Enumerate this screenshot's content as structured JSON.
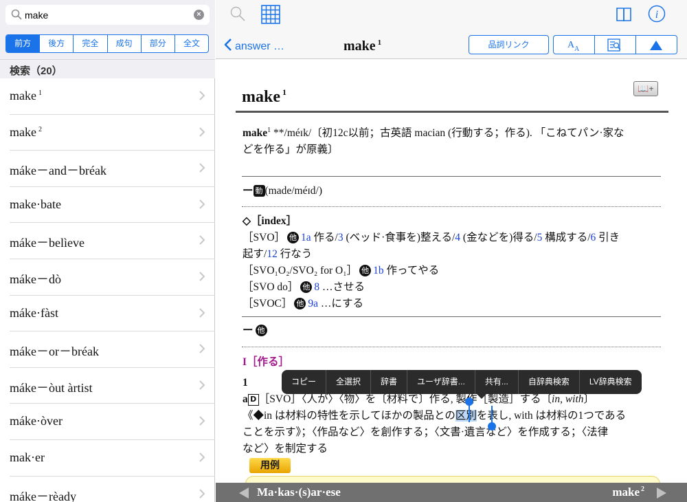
{
  "search": {
    "value": "make"
  },
  "modes": [
    {
      "label": "前方",
      "active": true
    },
    {
      "label": "後方",
      "active": false
    },
    {
      "label": "完全",
      "active": false
    },
    {
      "label": "成句",
      "active": false
    },
    {
      "label": "部分",
      "active": false
    },
    {
      "label": "全文",
      "active": false
    }
  ],
  "result_count": "検索（20）",
  "results": [
    {
      "word": "make",
      "sup": "1"
    },
    {
      "word": "make",
      "sup": "2"
    },
    {
      "word": "máke－and－bréak",
      "sup": ""
    },
    {
      "word": "make·bate",
      "sup": ""
    },
    {
      "word": "máke－belìeve",
      "sup": ""
    },
    {
      "word": "máke－dò",
      "sup": ""
    },
    {
      "word": "máke·fàst",
      "sup": ""
    },
    {
      "word": "máke－or－bréak",
      "sup": ""
    },
    {
      "word": "máke－òut àrtist",
      "sup": ""
    },
    {
      "word": "máke·òver",
      "sup": ""
    },
    {
      "word": "mak·er",
      "sup": ""
    },
    {
      "word": "máke－rèady",
      "sup": ""
    }
  ],
  "nav": {
    "back_label": "answer …",
    "title": "make",
    "title_sup": "1",
    "pos_link_label": "品詞リンク"
  },
  "entry": {
    "headword": "make",
    "headword_sup": "1",
    "add_icon_label": "📖+",
    "etym_head": "make",
    "etym_sup": "1",
    "etym_text1": " **/méɪk/〔初12c以前；古英語 macian (行動する；作る). 「こねてパン·家な",
    "etym_text2": "どを作る」が原義〕",
    "verb_dash": "ー",
    "verb_mark": "動",
    "verb_forms": "(made/méɪd/)",
    "index_head": "◇［index］",
    "svo_label": "［SVO］",
    "ta": "他",
    "svo_1a": "1a",
    "svo_1a_text": " 作る/",
    "svo_3": "3",
    "svo_3_text": " (ベッド·食事を)整える/",
    "svo_4": "4",
    "svo_4_text": " (金などを)得る/",
    "svo_5": "5",
    "svo_5_text": " 構成する/",
    "svo_6": "6",
    "svo_6_text": " 引き",
    "svo_line2a": "起す/",
    "svo_12": "12",
    "svo_line2b": " 行なう",
    "svoo_label": "［SVO₁O₂/SVO₂ for O₁］",
    "svoo_1b": "1b",
    "svoo_text": " 作ってやる",
    "svodo_label": "［SVO do］",
    "svodo_8": "8",
    "svodo_text": " …させる",
    "svoc_label": "［SVOC］",
    "svoc_9a": "9a",
    "svoc_text": " …にする",
    "ta_dash": "ー",
    "sense_head": "I［作る］",
    "sense_num": "1",
    "sense_a": "a",
    "sense_d": "D",
    "sense_line1": "［SVO］〈人が〉〈物〉を〔材料で〕作る, 製作［製造］する〔",
    "sense_in_with": "in, with",
    "sense_line1_end": "〕",
    "sense_line2a": "《◆in は材料の特性を示してほかの製品との",
    "sense_selected": "区別",
    "sense_line2b": "を表し, with は材料の1つである",
    "sense_line3": "ことを示す》；〈作品など〉を創作する；〈文書·遺言など〉を作成する；〈法律",
    "sense_line4": "など〉を制定する",
    "yourei": "用例"
  },
  "context_menu": [
    "コピー",
    "全選択",
    "辞書",
    "ユーザ辞書...",
    "共有...",
    "自辞典検索",
    "LV辞典検索"
  ],
  "bottom": {
    "prev": "Ma·kas·(s)ar·ese",
    "next": "make",
    "next_sup": "2"
  }
}
